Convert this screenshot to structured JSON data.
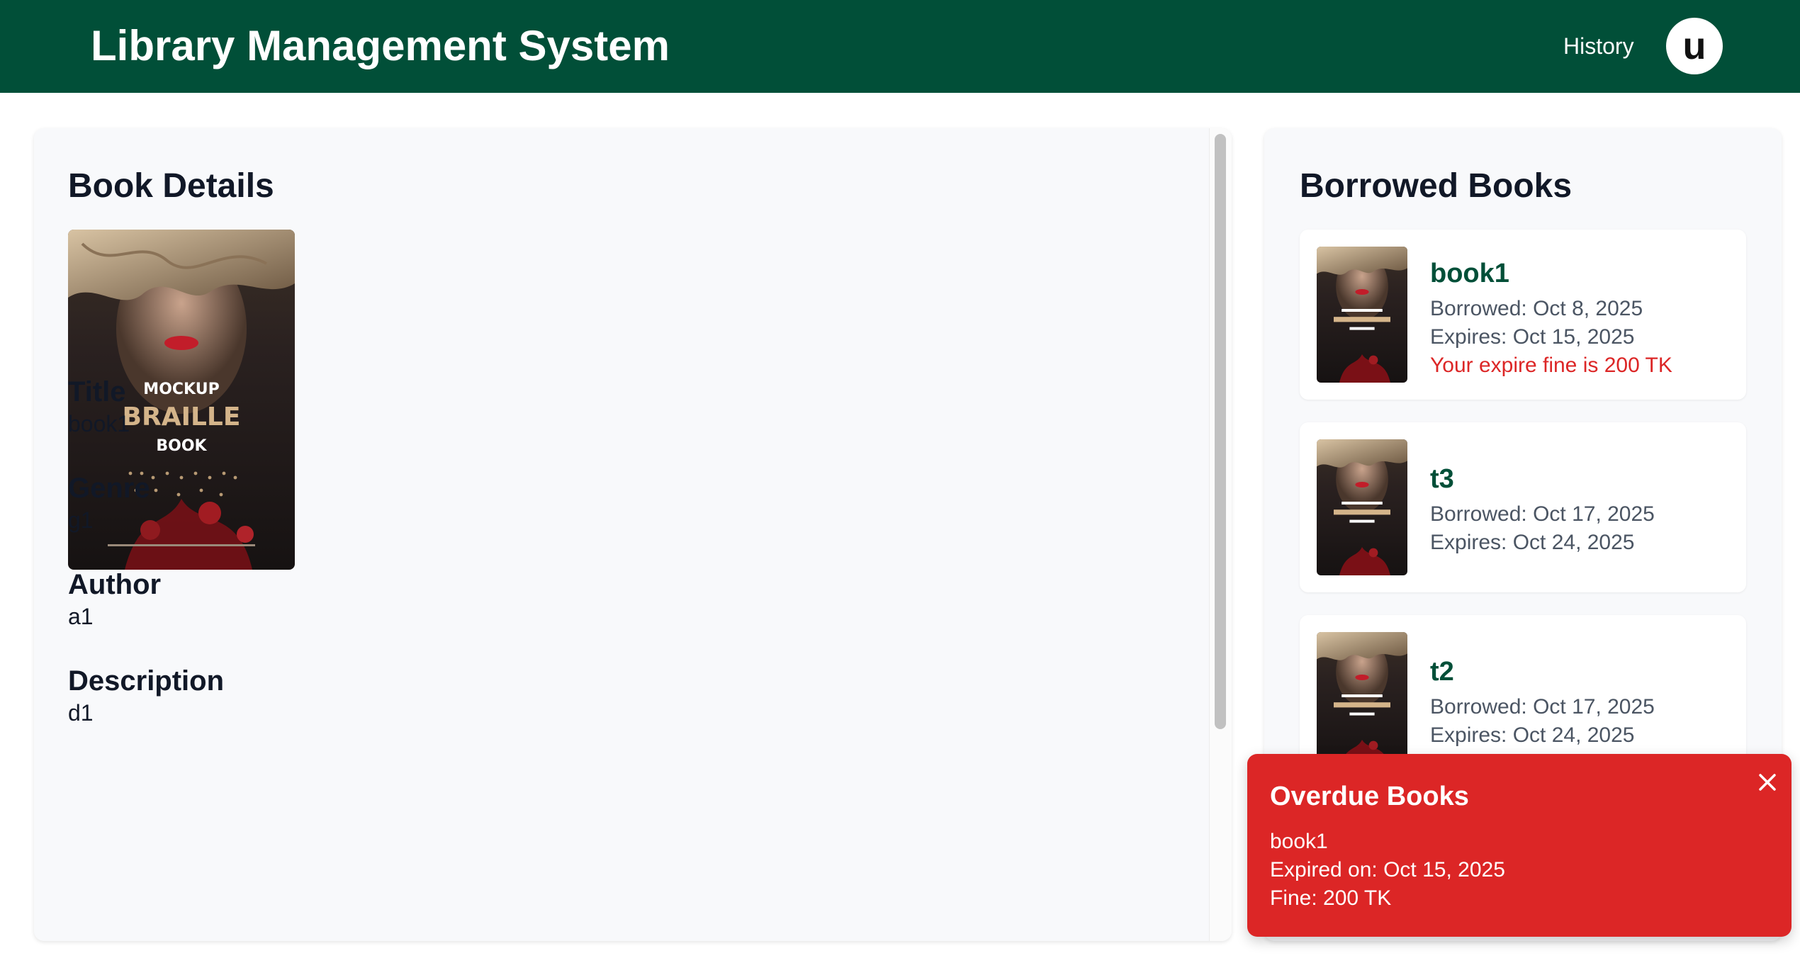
{
  "header": {
    "title": "Library Management System",
    "history_label": "History",
    "avatar_initial": "u"
  },
  "colors": {
    "header_bg": "#014f38",
    "accent": "#014f38",
    "danger": "#dc2626",
    "panel_bg": "#f8f9fb"
  },
  "details": {
    "heading": "Book Details",
    "cover": {
      "line1": "MOCKUP",
      "line2": "BRAILLE",
      "line3": "BOOK"
    },
    "fields": [
      {
        "label": "Title",
        "value": "book1"
      },
      {
        "label": "Genre",
        "value": "g1"
      },
      {
        "label": "Author",
        "value": "a1"
      },
      {
        "label": "Description",
        "value": "d1"
      }
    ]
  },
  "borrowed": {
    "heading": "Borrowed Books",
    "items": [
      {
        "title": "book1",
        "borrowed": "Borrowed: Oct 8, 2025",
        "expires": "Expires: Oct 15, 2025",
        "fine": "Your expire fine is 200 TK"
      },
      {
        "title": "t3",
        "borrowed": "Borrowed: Oct 17, 2025",
        "expires": "Expires: Oct 24, 2025"
      },
      {
        "title": "t2",
        "borrowed": "Borrowed: Oct 17, 2025",
        "expires": "Expires: Oct 24, 2025"
      }
    ]
  },
  "toast": {
    "title": "Overdue Books",
    "book": "book1",
    "expired": "Expired on: Oct 15, 2025",
    "fine": "Fine: 200 TK",
    "close_icon": "close-icon"
  }
}
